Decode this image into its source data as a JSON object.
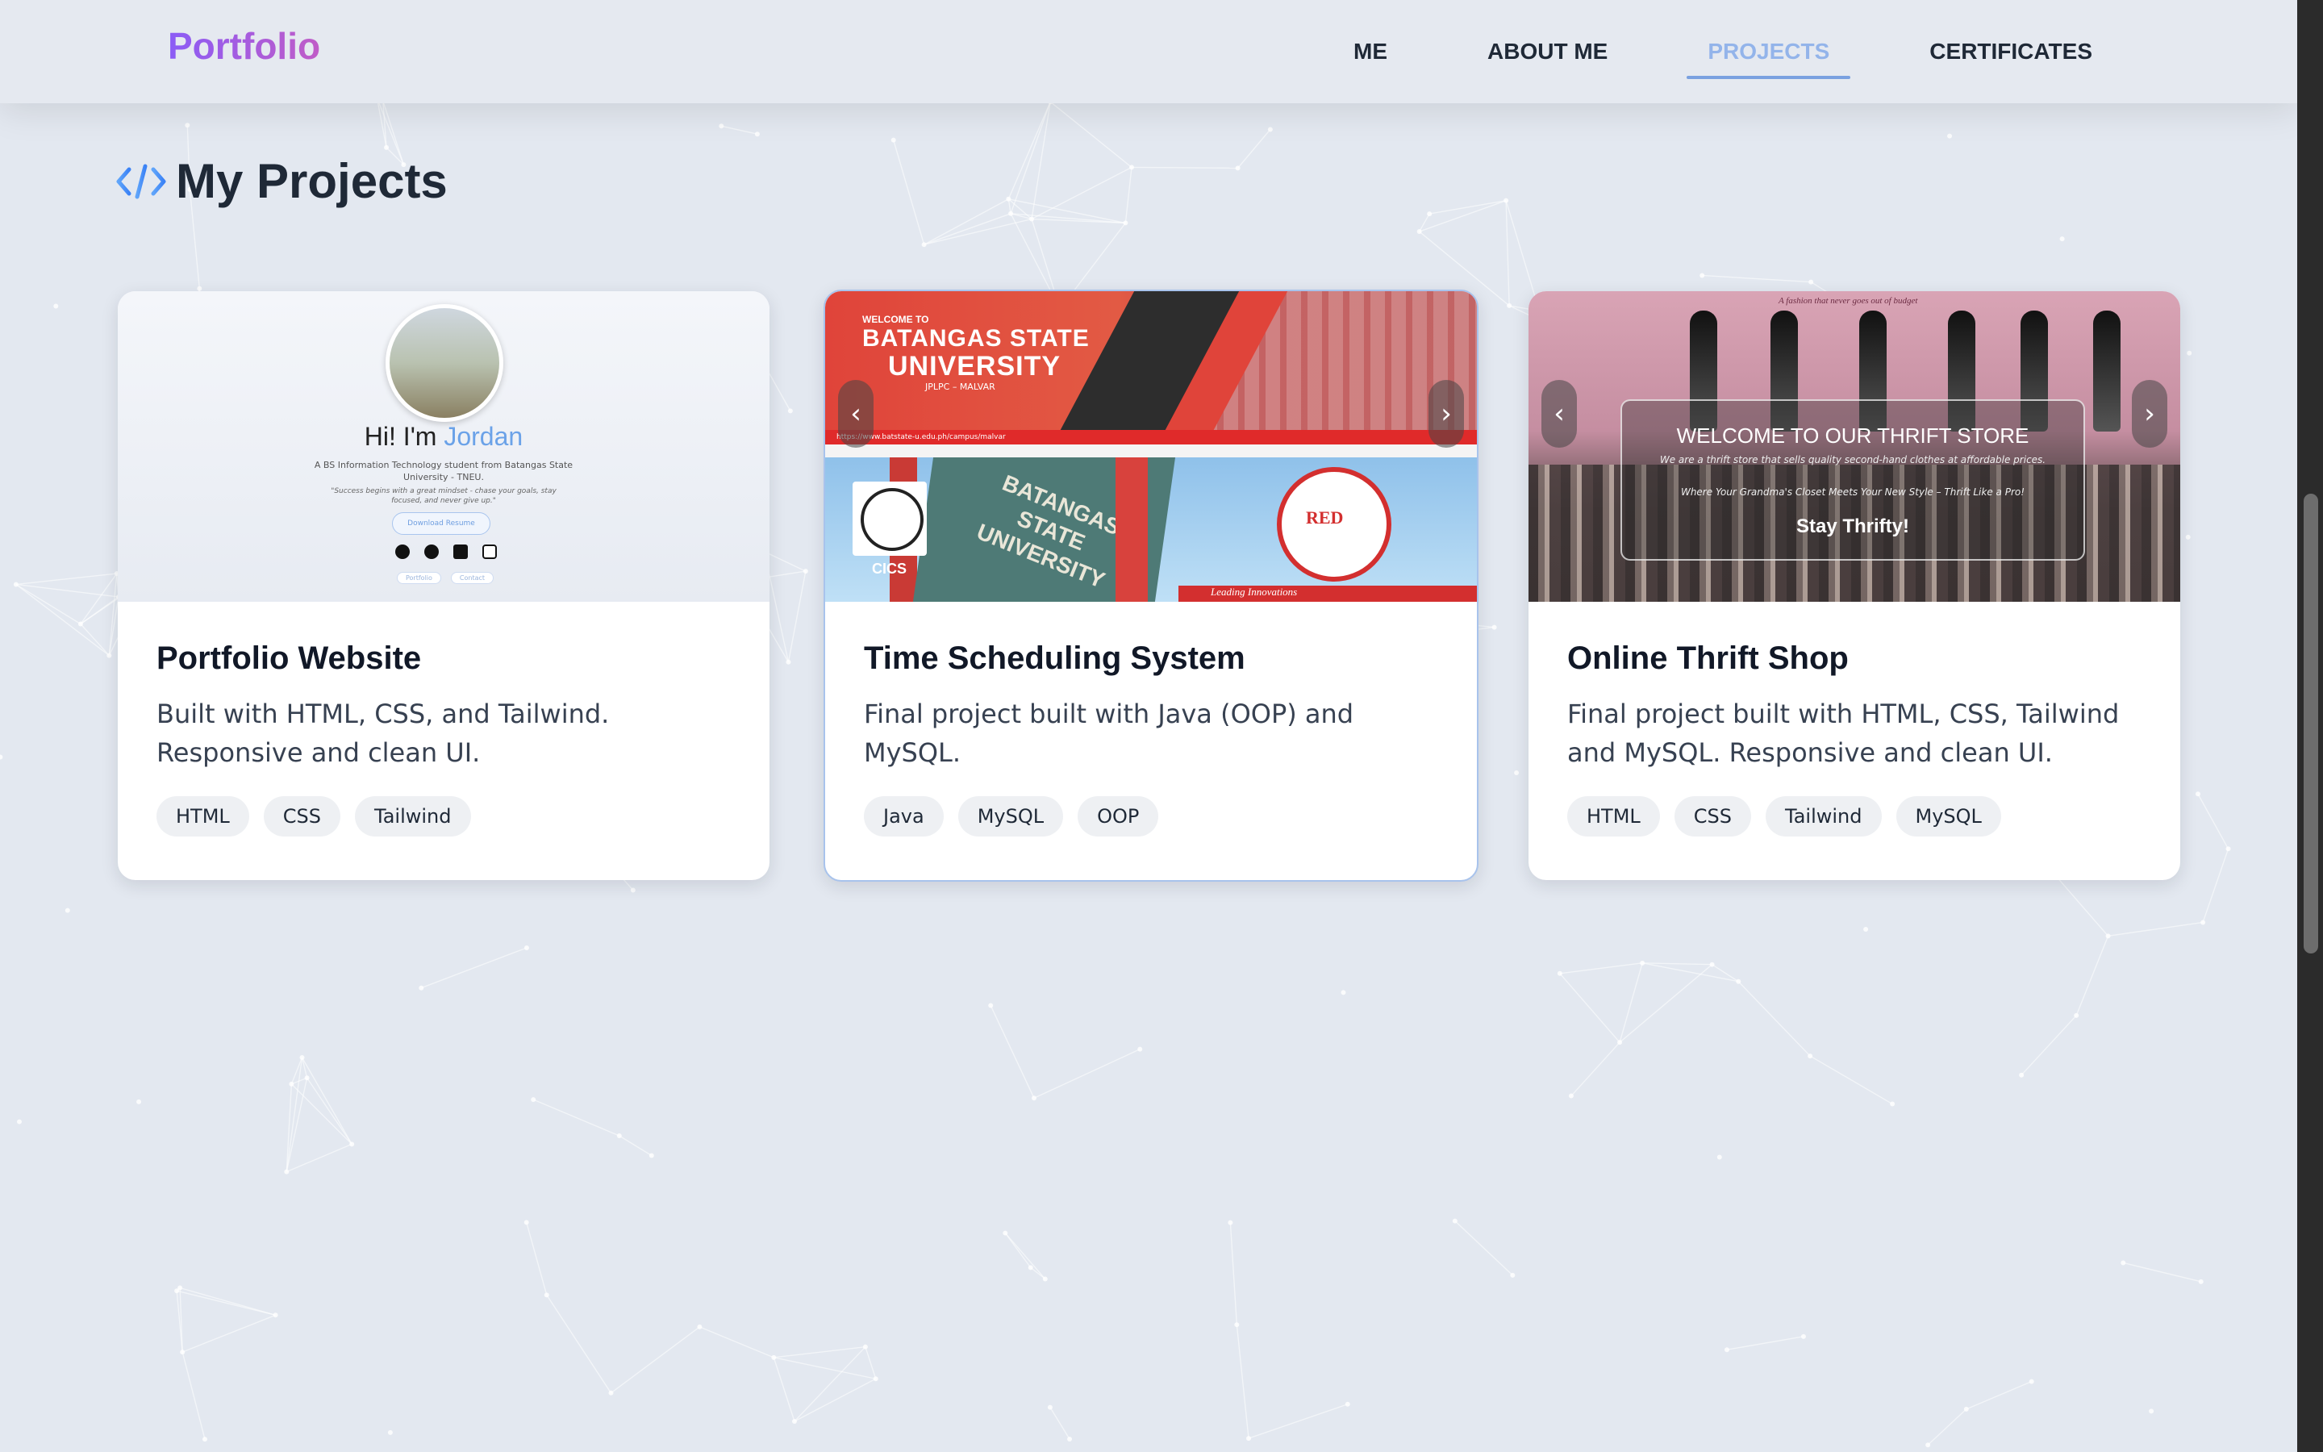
{
  "nav": {
    "brand": "Portfolio",
    "links": [
      {
        "label": "ME",
        "active": false
      },
      {
        "label": "ABOUT ME",
        "active": false
      },
      {
        "label": "PROJECTS",
        "active": true
      },
      {
        "label": "CERTIFICATES",
        "active": false
      }
    ]
  },
  "section": {
    "icon": "code-icon",
    "title": "My Projects"
  },
  "projects": [
    {
      "title": "Portfolio Website",
      "description": "Built with HTML, CSS, and Tailwind. Responsive and clean UI.",
      "tags": [
        "HTML",
        "CSS",
        "Tailwind"
      ],
      "preview": {
        "greeting": "Hi! I'm ",
        "name": "Jordan",
        "subtitle": "A BS Information Technology student from Batangas State University - TNEU.",
        "quote": "\"Success begins with a great mindset - chase your goals, stay focused, and never give up.\"",
        "button": "Download Resume",
        "pill_1": "Portfolio",
        "pill_2": "Contact"
      }
    },
    {
      "title": "Time Scheduling System",
      "description": "Final project built with Java (OOP) and MySQL.",
      "tags": [
        "Java",
        "MySQL",
        "OOP"
      ],
      "preview": {
        "welcome": "WELCOME TO",
        "name_line1": "BATANGAS STATE",
        "name_line2": "UNIVERSITY",
        "campus": "JPLPC – MALVAR",
        "url": "https://www.batstate-u.edu.ph/campus/malvar",
        "building_text": "BATANGAS STATE UNIVERSITY",
        "college": "CICS",
        "mascot": "RED",
        "tagline": "Leading Innovations"
      }
    },
    {
      "title": "Online Thrift Shop",
      "description": "Final project built with HTML, CSS, Tailwind and MySQL. Responsive and clean UI.",
      "tags": [
        "HTML",
        "CSS",
        "Tailwind",
        "MySQL"
      ],
      "preview": {
        "top_tagline": "A fashion that never goes out of budget",
        "heading": "WELCOME TO OUR THRIFT STORE",
        "line1": "We are a thrift store that sells quality second-hand clothes at affordable prices.",
        "line2": "Where Your Grandma's Closet Meets Your New Style – Thrift Like a Pro!",
        "cta": "Stay Thrifty!"
      }
    }
  ],
  "colors": {
    "background": "#e3e8f0",
    "accent": "#7aa1e0",
    "brand_gradient_start": "#8b5cf6",
    "brand_gradient_end": "#c05cc7"
  }
}
